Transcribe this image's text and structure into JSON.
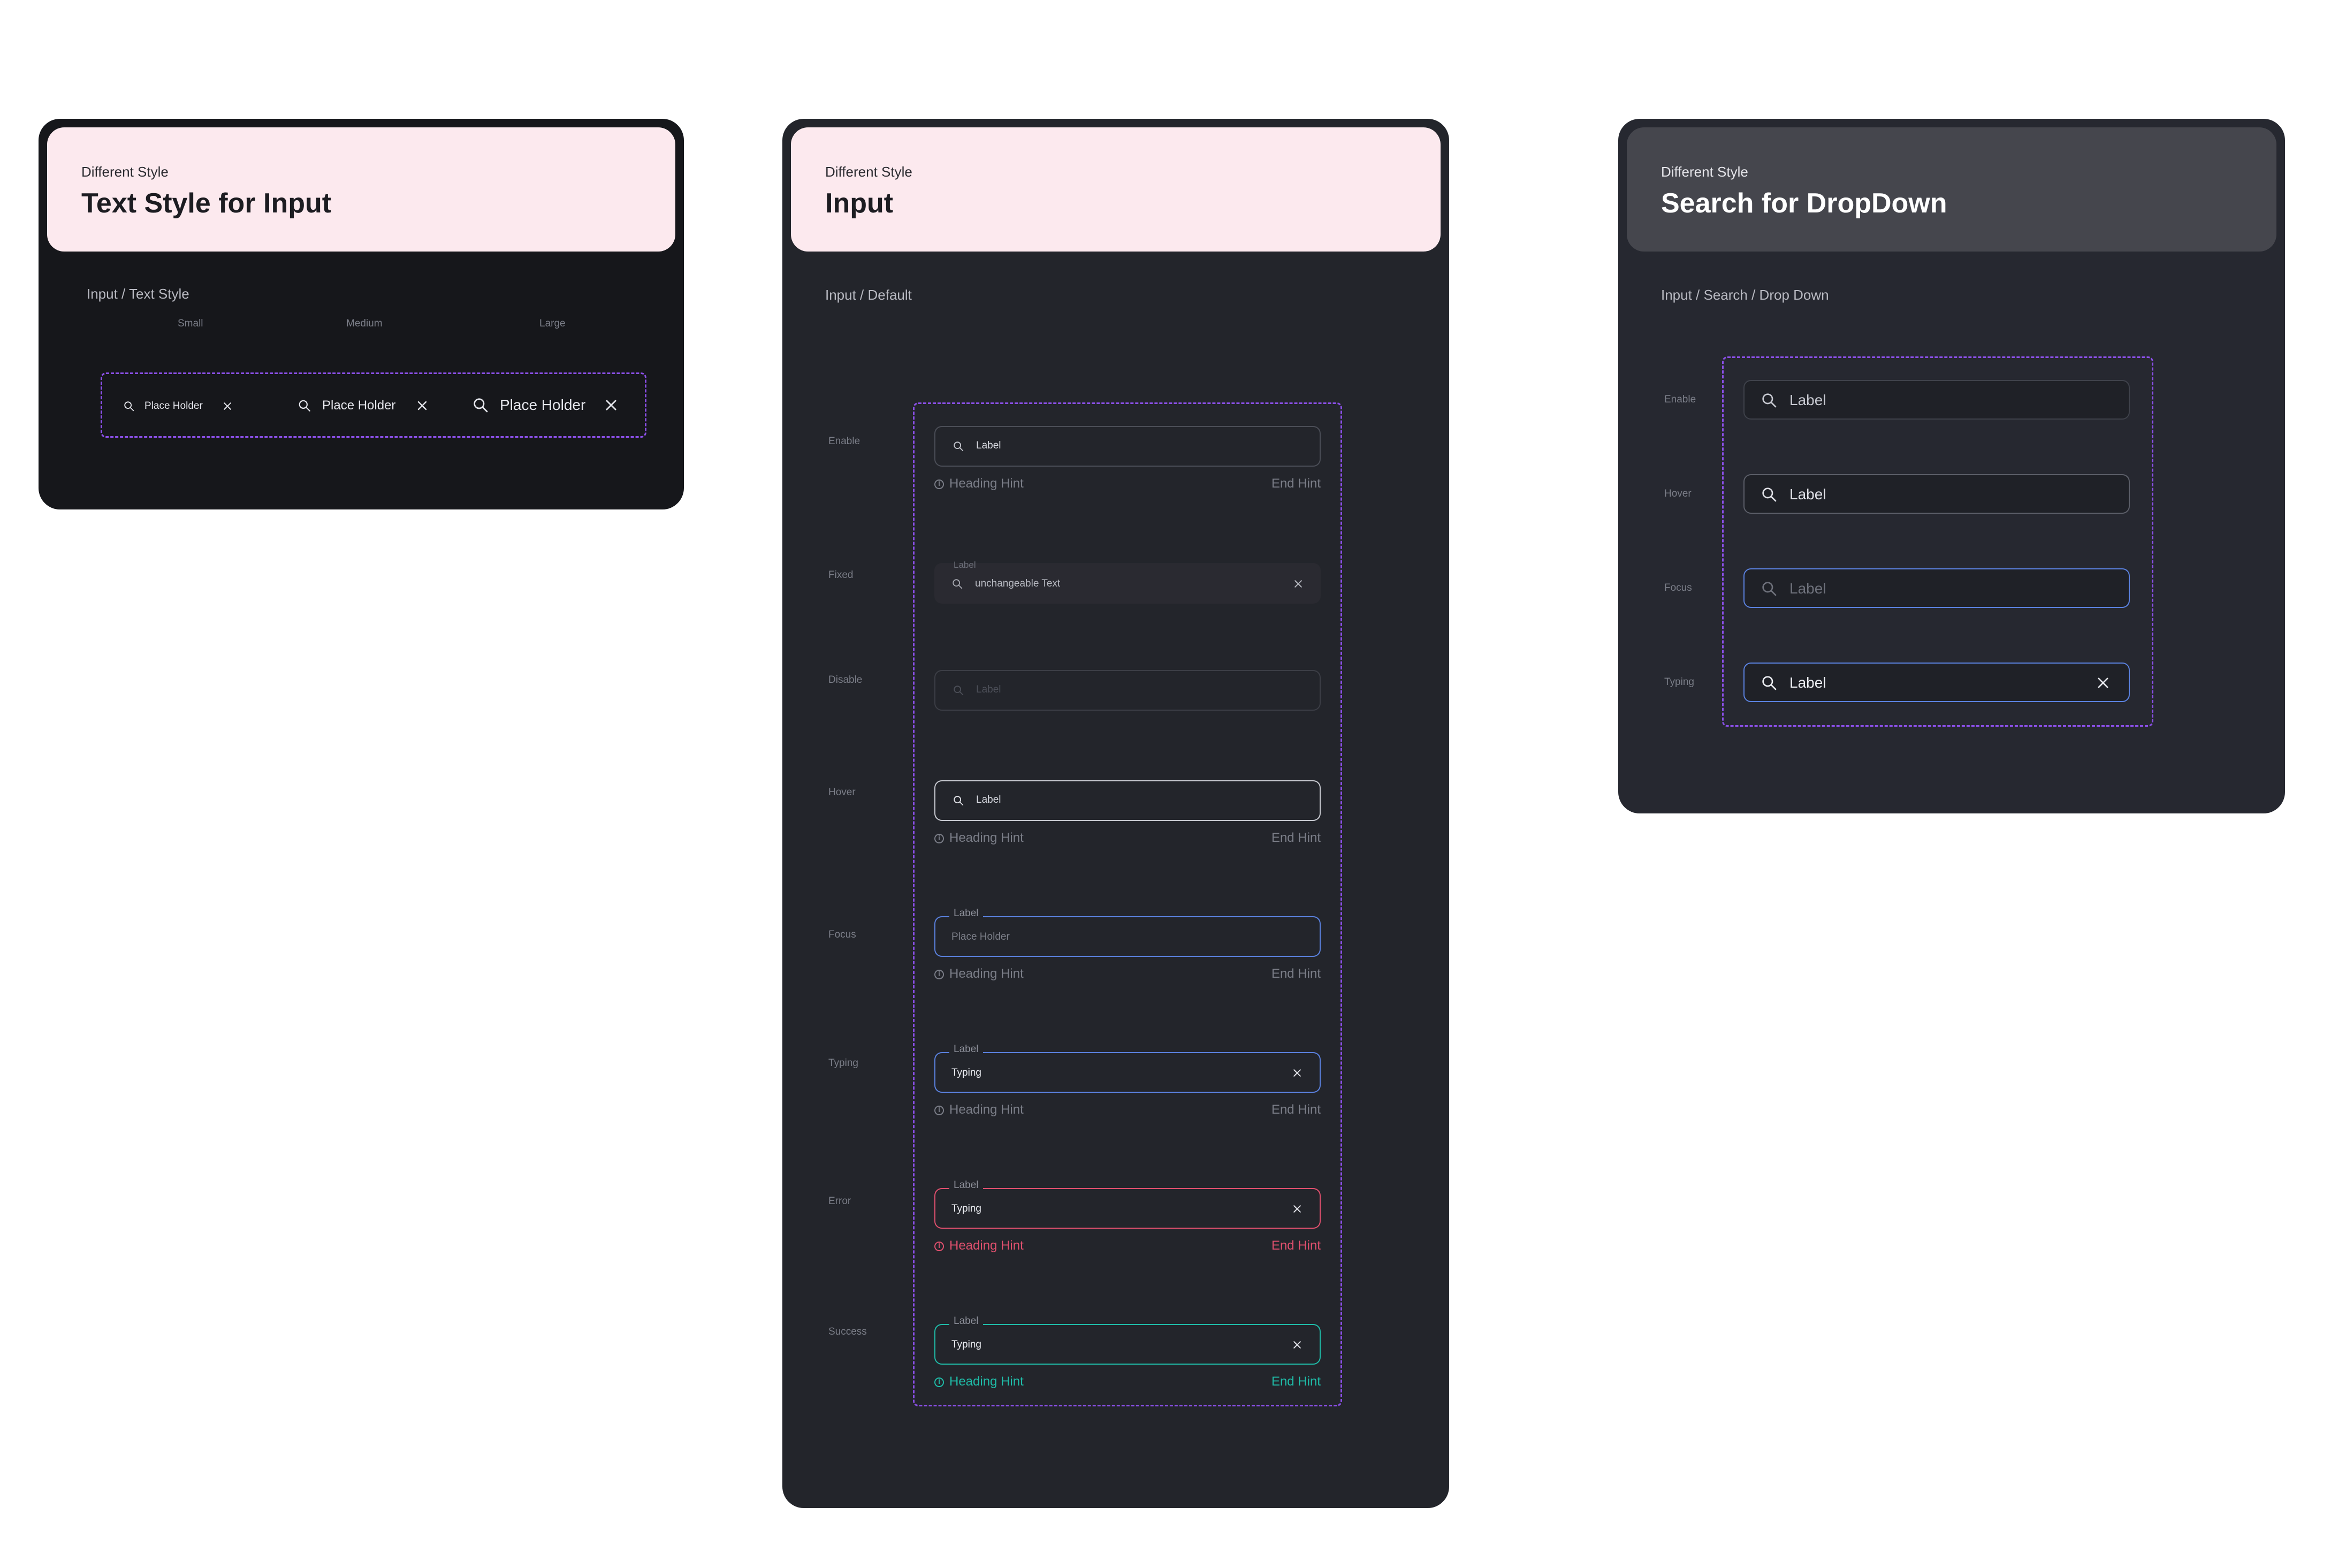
{
  "panel_text_style": {
    "subtitle": "Different Style",
    "title": "Text Style for Input",
    "section": "Input / Text Style",
    "sizes": [
      {
        "label": "Small",
        "placeholder": "Place Holder"
      },
      {
        "label": "Medium",
        "placeholder": "Place Holder"
      },
      {
        "label": "Large",
        "placeholder": "Place Holder"
      }
    ]
  },
  "panel_input": {
    "subtitle": "Different Style",
    "title": "Input",
    "section": "Input / Default",
    "states": [
      {
        "state": "Enable",
        "text": "Label",
        "hint": "Heading Hint",
        "end_hint": "End Hint"
      },
      {
        "state": "Fixed",
        "floating_label": "Label",
        "text": "unchangeable Text"
      },
      {
        "state": "Disable",
        "text": "Label"
      },
      {
        "state": "Hover",
        "text": "Label",
        "hint": "Heading Hint",
        "end_hint": "End Hint"
      },
      {
        "state": "Focus",
        "floating_label": "Label",
        "text": "Place Holder",
        "hint": "Heading Hint",
        "end_hint": "End Hint"
      },
      {
        "state": "Typing",
        "floating_label": "Label",
        "text": "Typing",
        "hint": "Heading Hint",
        "end_hint": "End Hint"
      },
      {
        "state": "Error",
        "floating_label": "Label",
        "text": "Typing",
        "hint": "Heading Hint",
        "end_hint": "End Hint"
      },
      {
        "state": "Success",
        "floating_label": "Label",
        "text": "Typing",
        "hint": "Heading Hint",
        "end_hint": "End Hint"
      }
    ]
  },
  "panel_search": {
    "subtitle": "Different Style",
    "title": "Search for DropDown",
    "section": "Input / Search / Drop Down",
    "states": [
      {
        "state": "Enable",
        "text": "Label"
      },
      {
        "state": "Hover",
        "text": "Label"
      },
      {
        "state": "Focus",
        "text": "Label"
      },
      {
        "state": "Typing",
        "text": "Label"
      }
    ]
  },
  "colors": {
    "panel_dark": "#16171b",
    "panel_mid": "#23252b",
    "panel_search": "#262830",
    "header_pink": "#fce9ee",
    "dashed_purple": "#8a4fe6",
    "focus_blue": "#5b82e0",
    "error_red": "#e0506e",
    "success_teal": "#1fbca8"
  },
  "icons": [
    "search-icon",
    "close-icon",
    "info-icon"
  ]
}
